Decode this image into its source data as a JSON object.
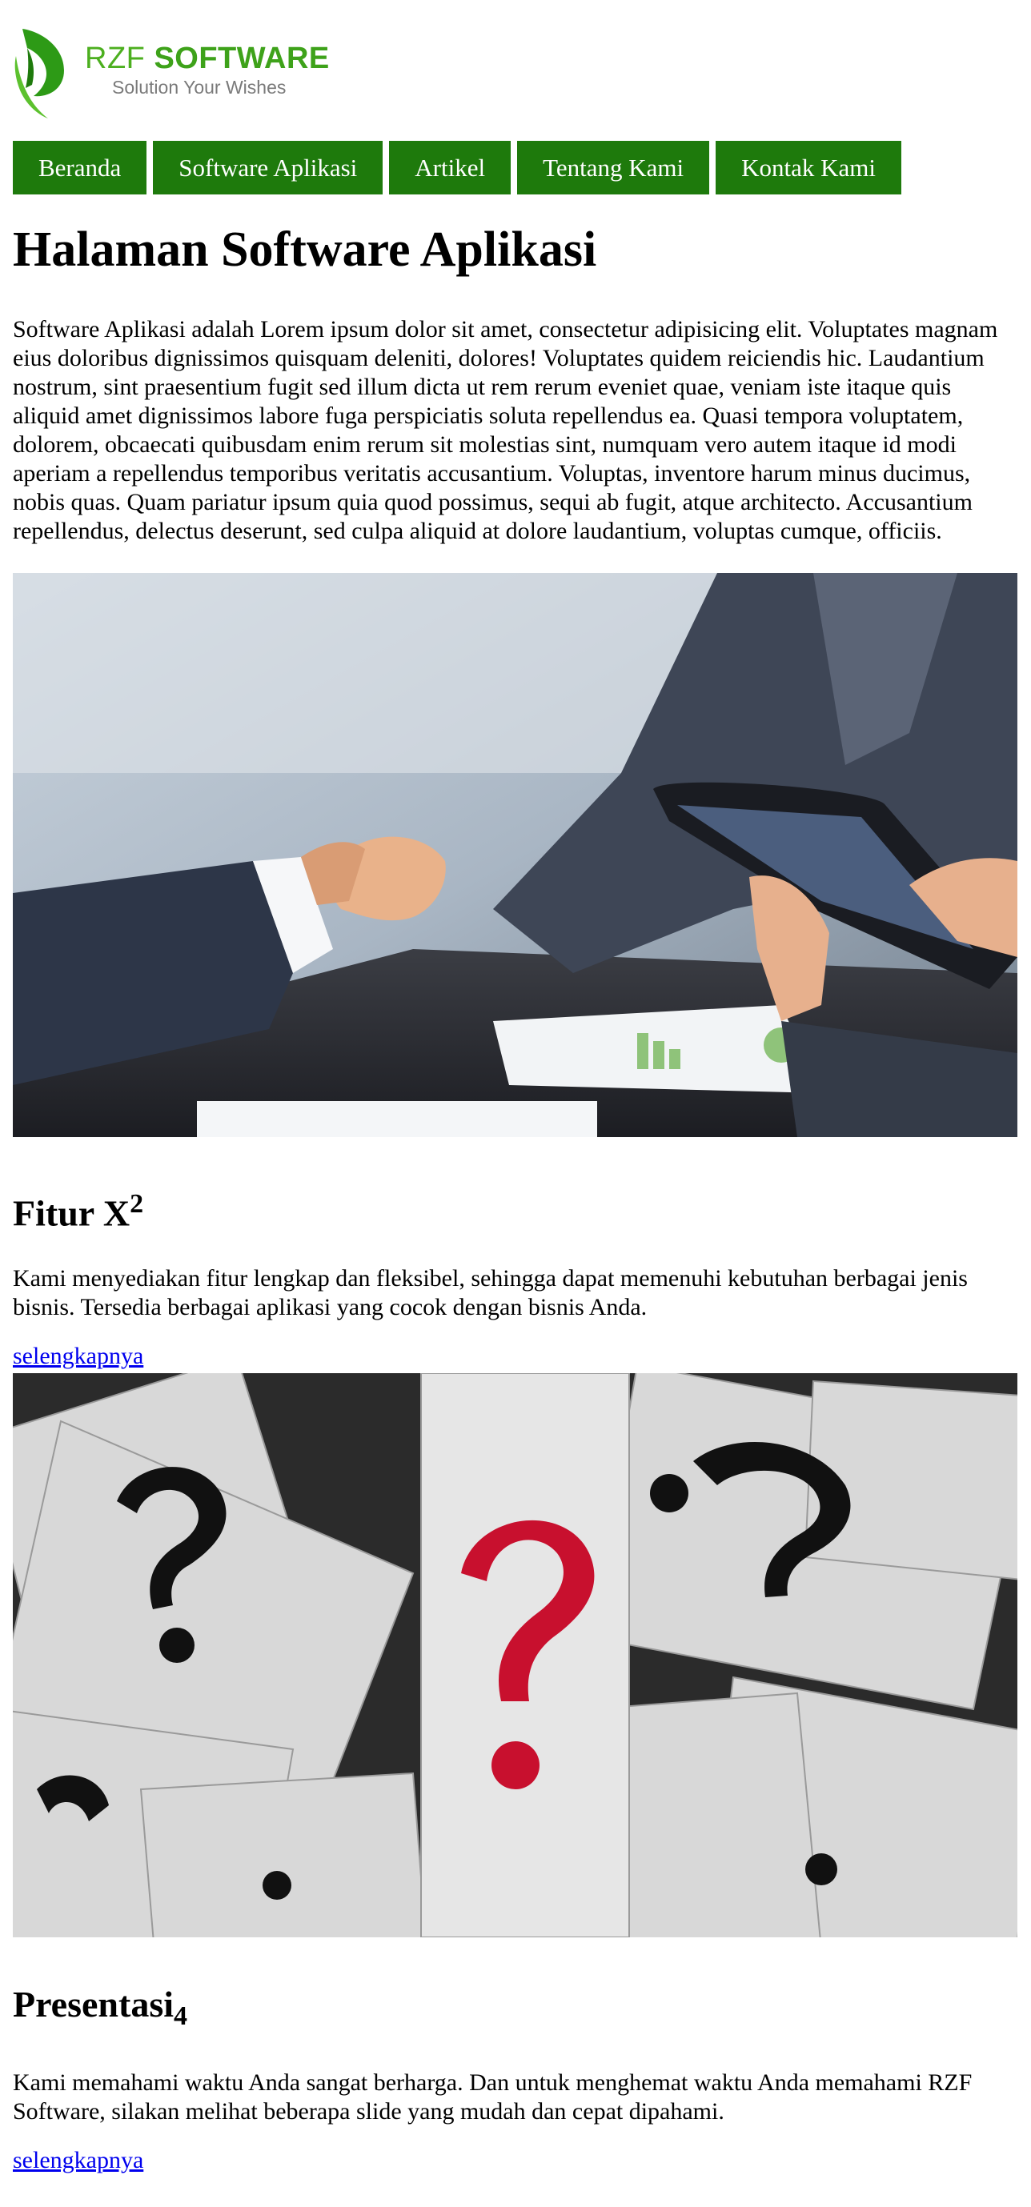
{
  "logo": {
    "brand_prefix": "RZF ",
    "brand_strong": "SOFTWARE",
    "tagline": "Solution Your Wishes",
    "accent_color": "#3ea21a"
  },
  "nav": {
    "color": "#1e7a0c",
    "items": [
      {
        "label": "Beranda"
      },
      {
        "label": "Software Aplikasi"
      },
      {
        "label": "Artikel"
      },
      {
        "label": "Tentang Kami"
      },
      {
        "label": "Kontak Kami"
      }
    ]
  },
  "page": {
    "title": "Halaman Software Aplikasi",
    "intro": "Software Aplikasi adalah Lorem ipsum dolor sit amet, consectetur adipisicing elit. Voluptates magnam eius doloribus dignissimos quisquam deleniti, dolores! Voluptates quidem reiciendis hic. Laudantium nostrum, sint praesentium fugit sed illum dicta ut rem rerum eveniet quae, veniam iste itaque quis aliquid amet dignissimos labore fuga perspiciatis soluta repellendus ea. Quasi tempora voluptatem, dolorem, obcaecati quibusdam enim rerum sit molestias sint, numquam vero autem itaque id modi aperiam a repellendus temporibus veritatis accusantium. Voluptas, inventore harum minus ducimus, nobis quas. Quam pariatur ipsum quia quod possimus, sequi ab fugit, atque architecto. Accusantium repellendus, delectus deserunt, sed culpa aliquid at dolore laudantium, voluptas cumque, officiis."
  },
  "sections": [
    {
      "heading": "Fitur X",
      "heading_sup": "2",
      "text": "Kami menyediakan fitur lengkap dan fleksibel, sehingga dapat memenuhi kebutuhan berbagai jenis bisnis. Tersedia berbagai aplikasi yang cocok dengan bisnis Anda.",
      "link": "selengkapnya"
    },
    {
      "heading": "Presentasi",
      "heading_sub": "4",
      "text": "Kami memahami waktu Anda sangat berharga. Dan untuk menghemat waktu Anda memahami RZF Software, silakan melihat beberapa slide yang mudah dan cepat dipahami.",
      "link": "selengkapnya"
    }
  ],
  "images": {
    "handshake": {
      "icon": "handshake-photo"
    },
    "question": {
      "icon": "question-marks-photo",
      "accent_color": "#c8102e"
    }
  }
}
